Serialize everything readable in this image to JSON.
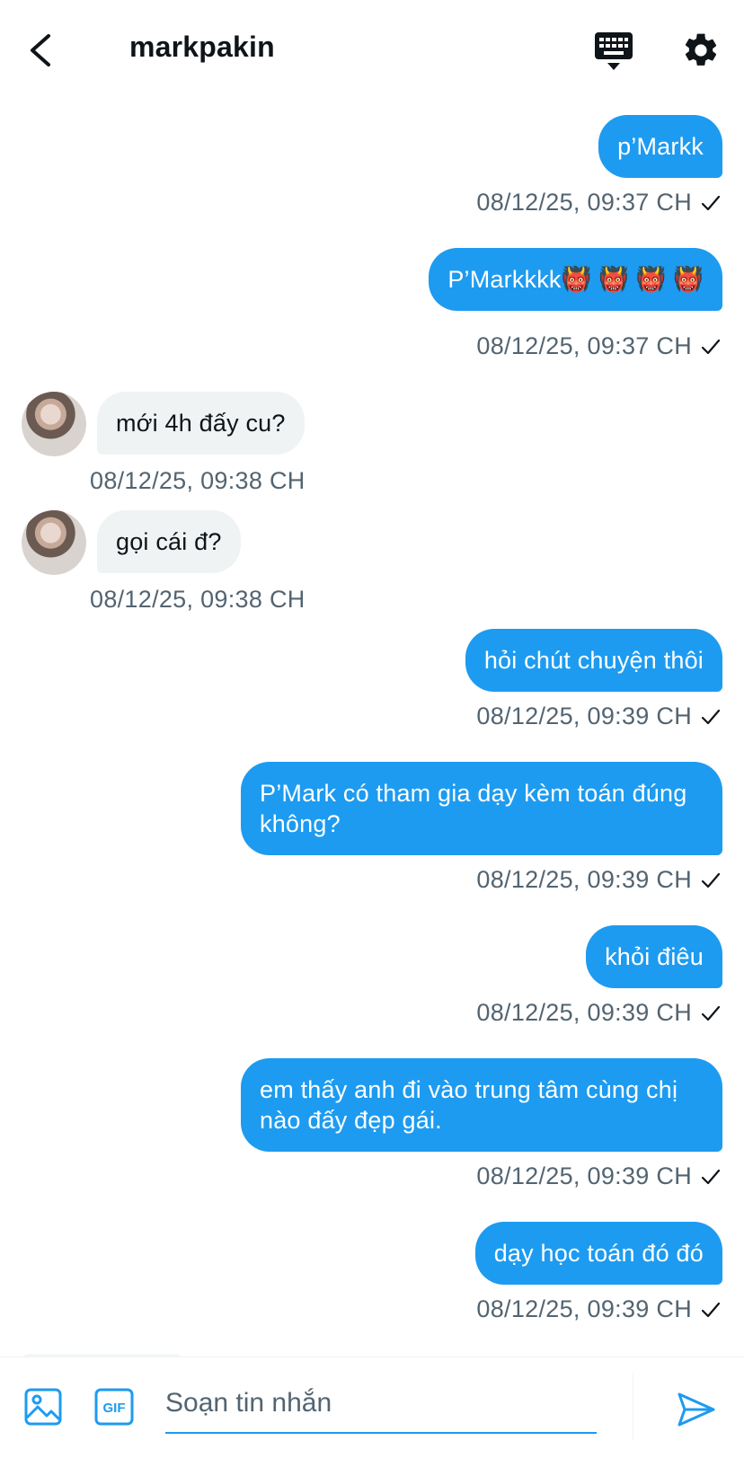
{
  "header": {
    "title": "markpakin",
    "back_icon": "chevron-left-icon",
    "keyboard_icon": "keyboard-icon",
    "settings_icon": "gear-icon"
  },
  "messages": [
    {
      "dir": "out",
      "text": "p’Markk",
      "time": "08/12/25, 09:37 CH"
    },
    {
      "dir": "out",
      "text": "P’Markkkk👹 👹 👹 👹",
      "time": "08/12/25, 09:37 CH"
    },
    {
      "dir": "in",
      "text": "mới 4h đấy cu?",
      "time": "08/12/25, 09:38 CH"
    },
    {
      "dir": "in",
      "text": "gọi cái đ?",
      "time": "08/12/25, 09:38 CH"
    },
    {
      "dir": "out",
      "text": "hỏi chút chuyện thôi",
      "time": "08/12/25, 09:39 CH"
    },
    {
      "dir": "out",
      "text": "P’Mark có tham gia dạy kèm toán đúng không?",
      "time": "08/12/25, 09:39 CH"
    },
    {
      "dir": "out",
      "text": "khỏi điêu",
      "time": "08/12/25, 09:39 CH"
    },
    {
      "dir": "out",
      "text": "em thấy anh đi vào trung tâm cùng chị nào đấy đẹp gái.",
      "time": "08/12/25, 09:39 CH"
    },
    {
      "dir": "out",
      "text": "dạy học toán đó đó",
      "time": "08/12/25, 09:39 CH"
    }
  ],
  "composer": {
    "placeholder": "Soạn tin nhắn",
    "image_icon": "image-icon",
    "gif_label": "GIF",
    "send_icon": "send-icon"
  },
  "colors": {
    "accent": "#1d9bf0",
    "incoming_bubble": "#eff3f4",
    "meta_text": "#536471"
  }
}
